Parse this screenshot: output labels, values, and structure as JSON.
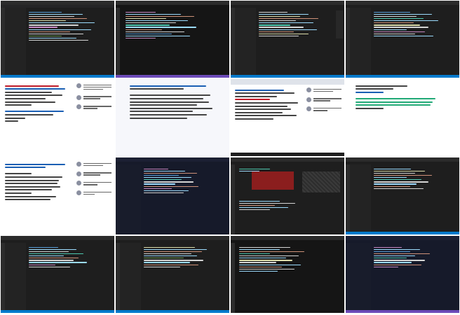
{
  "tiles": [
    {
      "kind": "editor",
      "theme": "dark"
    },
    {
      "kind": "editor",
      "theme": "dark"
    },
    {
      "kind": "editor",
      "theme": "dark"
    },
    {
      "kind": "editor",
      "theme": "dark"
    },
    {
      "kind": "chat-document",
      "theme": "light"
    },
    {
      "kind": "document",
      "theme": "light"
    },
    {
      "kind": "browser-chat",
      "theme": "light"
    },
    {
      "kind": "document",
      "theme": "light"
    },
    {
      "kind": "chat-document",
      "theme": "light"
    },
    {
      "kind": "editor",
      "theme": "navy"
    },
    {
      "kind": "editor-error",
      "theme": "dark"
    },
    {
      "kind": "editor",
      "theme": "dark"
    },
    {
      "kind": "editor",
      "theme": "dark"
    },
    {
      "kind": "editor",
      "theme": "dark"
    },
    {
      "kind": "editor",
      "theme": "dark"
    },
    {
      "kind": "editor",
      "theme": "navy"
    }
  ],
  "colors": {
    "accent": "#007acc",
    "error": "#8b1e1e",
    "link": "#1a5fb4"
  }
}
